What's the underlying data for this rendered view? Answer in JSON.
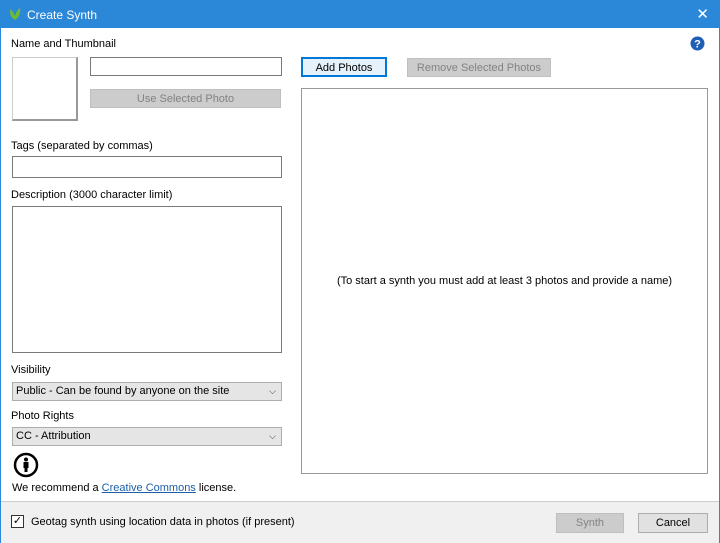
{
  "window": {
    "title": "Create Synth",
    "close_icon": "close-icon",
    "app_icon": "leaf-logo-icon"
  },
  "left": {
    "name_label": "Name and Thumbnail",
    "name_value": "",
    "use_selected_photo": "Use Selected Photo",
    "tags_label": "Tags (separated by commas)",
    "tags_value": "",
    "description_label": "Description (3000 character limit)",
    "description_value": "",
    "visibility_label": "Visibility",
    "visibility_value": "Public - Can be found by anyone on the site",
    "rights_label": "Photo Rights",
    "rights_value": "CC - Attribution",
    "recommend_prefix": "We recommend a ",
    "recommend_link": "Creative Commons",
    "recommend_suffix": " license."
  },
  "right": {
    "add_photos": "Add Photos",
    "remove_selected": "Remove Selected Photos",
    "placeholder": "(To start a synth you must add at least 3 photos and provide a name)"
  },
  "footer": {
    "geotag_label": "Geotag synth using location data in photos (if present)",
    "geotag_checked": true,
    "synth": "Synth",
    "cancel": "Cancel"
  }
}
